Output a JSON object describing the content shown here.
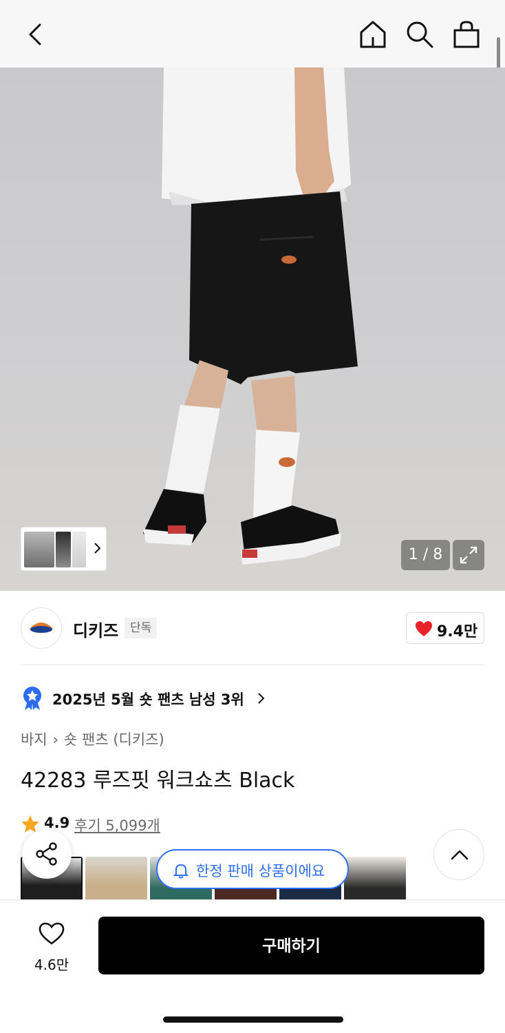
{
  "image_counter": "1 / 8",
  "brand": {
    "name": "디키즈",
    "badge": "단독",
    "likes": "9.4만"
  },
  "ranking": {
    "text": "2025년 5월 숏 팬츠 남성 3위"
  },
  "breadcrumb": {
    "items": [
      "바지",
      "숏 팬츠 (디키즈)"
    ]
  },
  "product": {
    "title": "42283 루즈핏 워크쇼츠 Black"
  },
  "rating": {
    "score": "4.9",
    "reviews": "후기 5,099개"
  },
  "limited_notice": "한정 판매 상품이에요",
  "bottom": {
    "wish_count": "4.6만",
    "buy_label": "구매하기"
  },
  "colors": {
    "like_red": "#e8242a",
    "accent_blue": "#2e6ff2",
    "star": "#f5a623",
    "rank_medal": "#2d6bf0"
  }
}
